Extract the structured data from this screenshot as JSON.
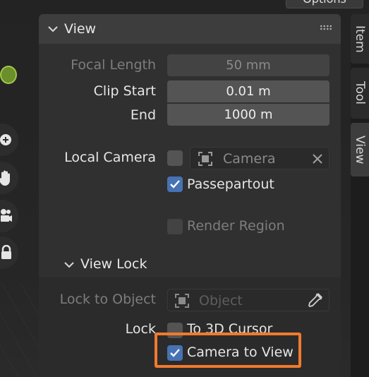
{
  "header": {
    "options_label": "Options"
  },
  "sidebar_tabs": [
    {
      "label": "Item"
    },
    {
      "label": "Tool"
    },
    {
      "label": "View"
    }
  ],
  "view_panel": {
    "title": "View",
    "focal_length": {
      "label": "Focal Length",
      "value": "50 mm"
    },
    "clip_start": {
      "label": "Clip Start",
      "value": "0.01 m"
    },
    "clip_end": {
      "label": "End",
      "value": "1000 m"
    },
    "local_camera": {
      "label": "Local Camera",
      "placeholder": "Camera"
    },
    "passepartout": {
      "label": "Passepartout",
      "checked": true
    },
    "render_region": {
      "label": "Render Region",
      "checked": false
    }
  },
  "view_lock_panel": {
    "title": "View Lock",
    "lock_to_object": {
      "label": "Lock to Object",
      "placeholder": "Object"
    },
    "lock": {
      "label": "Lock"
    },
    "to_3d_cursor": {
      "label": "To 3D Cursor",
      "checked": false
    },
    "camera_to_view": {
      "label": "Camera to View",
      "checked": true
    }
  },
  "colors": {
    "accent": "#4772b3",
    "highlight": "#f07a2d"
  },
  "icons": [
    "chevron-down-icon",
    "drag-handle-icon",
    "camera-object-icon",
    "close-icon",
    "eyedropper-icon",
    "zoom-plus-icon",
    "hand-pan-icon",
    "camera-icon",
    "lock-icon"
  ]
}
